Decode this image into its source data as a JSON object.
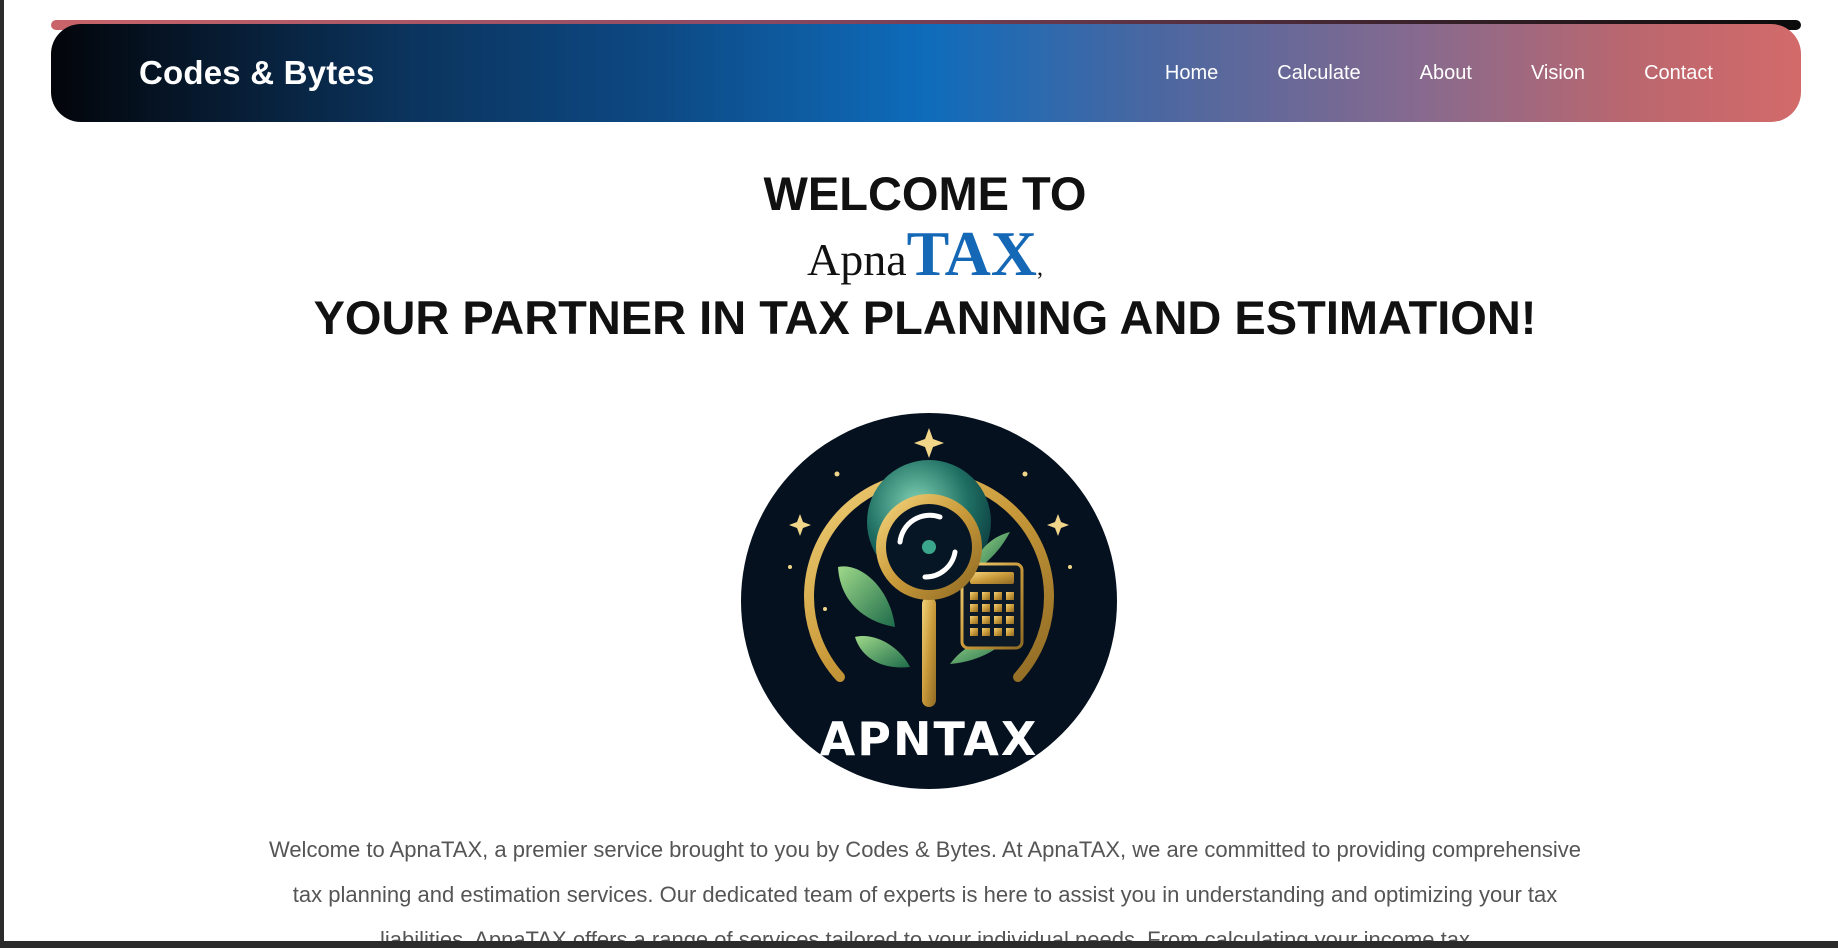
{
  "navbar": {
    "brand": "Codes & Bytes",
    "links": [
      "Home",
      "Calculate",
      "About",
      "Vision",
      "Contact"
    ]
  },
  "hero": {
    "welcome": "WELCOME TO",
    "brand_apna": "Apna",
    "brand_tax": "TAX",
    "brand_comma": ",",
    "tagline": "YOUR PARTNER IN TAX PLANNING AND ESTIMATION!"
  },
  "logo": {
    "text": "APNTAX",
    "icon": "magnifier-leaf-calculator-logo"
  },
  "intro": {
    "text": "Welcome to ApnaTAX, a premier service brought to you by Codes & Bytes. At ApnaTAX, we are committed to providing comprehensive tax planning and estimation services. Our dedicated team of experts is here to assist you in understanding and optimizing your tax liabilities. ApnaTAX offers a range of services tailored to your individual needs. From calculating your income tax"
  },
  "colors": {
    "accent": "#1468b6",
    "logo_bg": "#06111f",
    "gold": "#d4a84a"
  }
}
